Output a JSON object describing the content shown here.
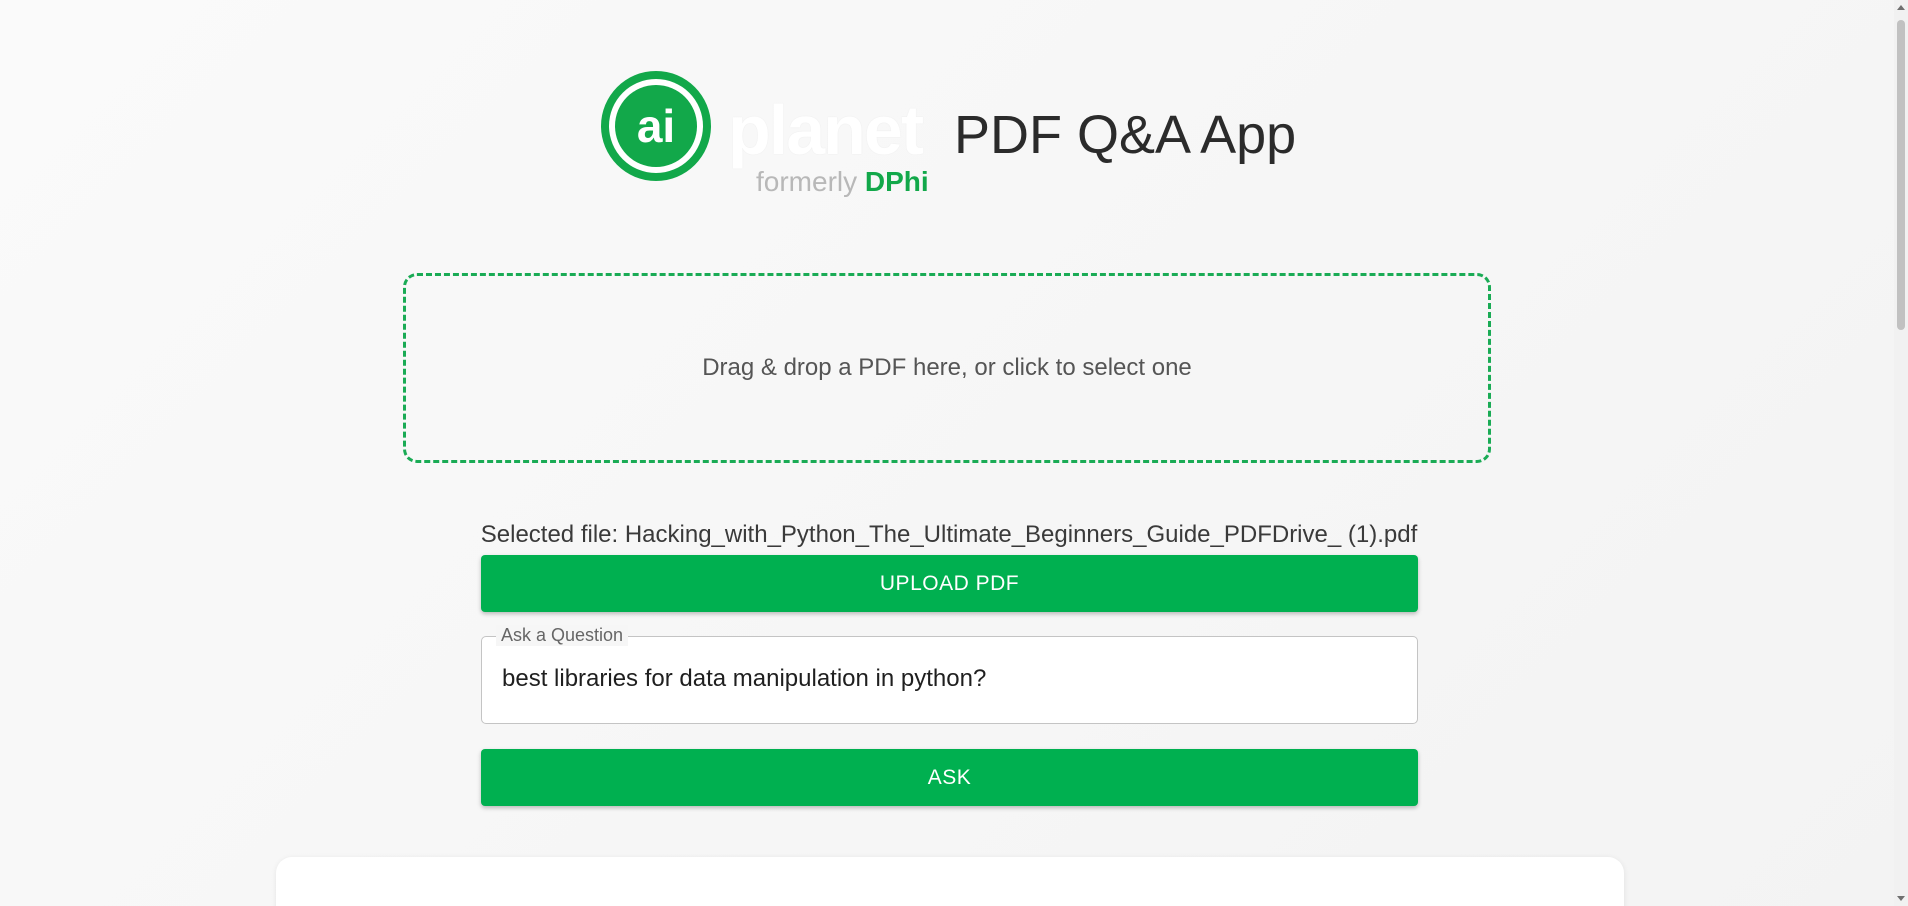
{
  "header": {
    "logo": {
      "mark_text": "ai",
      "word": "planet",
      "sub_prefix": "formerly",
      "sub_brand": "DPhi",
      "brand_color": "#12a84a"
    },
    "title": "PDF Q&A App"
  },
  "dropzone": {
    "text": "Drag & drop a PDF here, or click to select one",
    "border_color": "#1aab55"
  },
  "selected_file": {
    "text": "Selected file: Hacking_with_Python_The_Ultimate_Beginners_Guide_PDFDrive_ (1).pdf"
  },
  "upload_button": {
    "label": "UPLOAD PDF",
    "color": "#00b050"
  },
  "question_field": {
    "label": "Ask a Question",
    "value": "best libraries for data manipulation in python?"
  },
  "ask_button": {
    "label": "ASK",
    "color": "#00b050"
  }
}
